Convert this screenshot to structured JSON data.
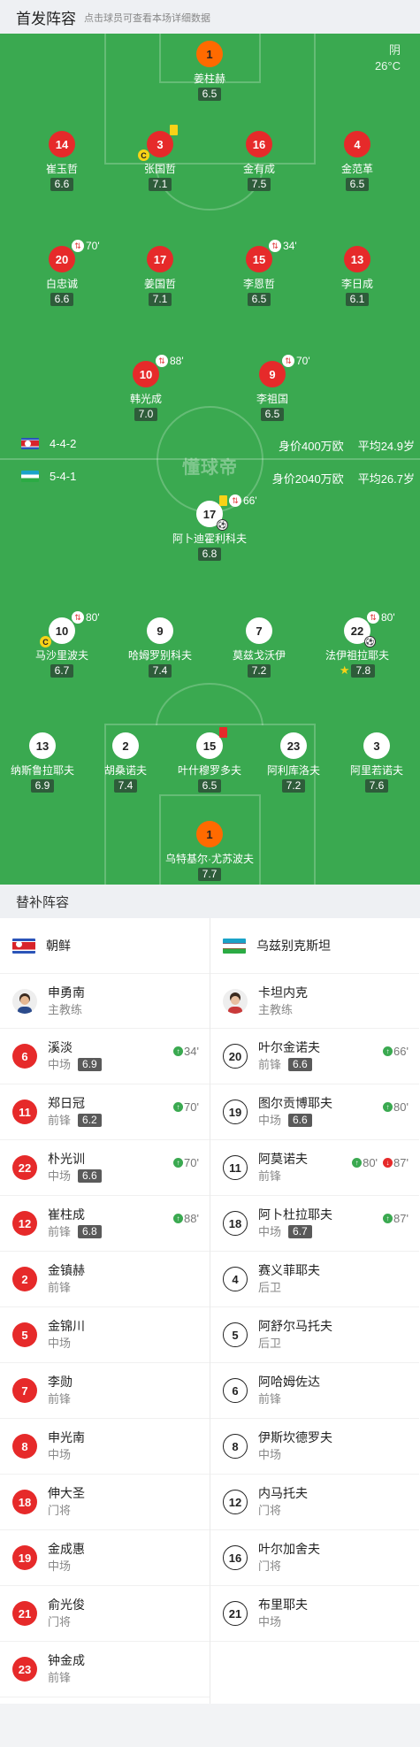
{
  "header": {
    "title": "首发阵容",
    "subtitle": "点击球员可查看本场详细数据"
  },
  "weather": {
    "condition": "阴",
    "temp": "26°C"
  },
  "watermark": "懂球帝",
  "home": {
    "formation": "4-4-2",
    "value": "身价400万欧",
    "age": "平均24.9岁",
    "name": "朝鲜",
    "players": [
      {
        "num": "1",
        "name": "姜柱赫",
        "rating": "6.5",
        "kit": "or"
      },
      {
        "num": "14",
        "name": "崔玉哲",
        "rating": "6.6",
        "kit": "red"
      },
      {
        "num": "3",
        "name": "张国哲",
        "rating": "7.1",
        "kit": "red",
        "captain": "C",
        "yellow": true
      },
      {
        "num": "16",
        "name": "金有成",
        "rating": "7.5",
        "kit": "red"
      },
      {
        "num": "4",
        "name": "金范革",
        "rating": "6.5",
        "kit": "red"
      },
      {
        "num": "20",
        "name": "白忠诚",
        "rating": "6.6",
        "kit": "red",
        "sub": "70'"
      },
      {
        "num": "17",
        "name": "姜国哲",
        "rating": "7.1",
        "kit": "red"
      },
      {
        "num": "15",
        "name": "李恩哲",
        "rating": "6.5",
        "kit": "red",
        "sub": "34'"
      },
      {
        "num": "13",
        "name": "李日成",
        "rating": "6.1",
        "kit": "red"
      },
      {
        "num": "10",
        "name": "韩光成",
        "rating": "7.0",
        "kit": "red",
        "sub": "88'"
      },
      {
        "num": "9",
        "name": "李祖国",
        "rating": "6.5",
        "kit": "red",
        "sub": "70'"
      }
    ]
  },
  "away": {
    "formation": "5-4-1",
    "value": "身价2040万欧",
    "age": "平均26.7岁",
    "name": "乌兹别克斯坦",
    "players": [
      {
        "num": "17",
        "name": "阿卜迪霍利科夫",
        "rating": "6.8",
        "kit": "wh",
        "yellow": true,
        "sub": "66'"
      },
      {
        "num": "10",
        "name": "马沙里波夫",
        "rating": "6.7",
        "kit": "wh",
        "captain": "C",
        "sub": "80'"
      },
      {
        "num": "9",
        "name": "哈姆罗别科夫",
        "rating": "7.4",
        "kit": "wh"
      },
      {
        "num": "7",
        "name": "莫兹戈沃伊",
        "rating": "7.2",
        "kit": "wh"
      },
      {
        "num": "22",
        "name": "法伊祖拉耶夫",
        "rating": "7.8",
        "kit": "wh",
        "sub": "80'",
        "star": "★"
      },
      {
        "num": "13",
        "name": "纳斯鲁拉耶夫",
        "rating": "6.9",
        "kit": "wh"
      },
      {
        "num": "2",
        "name": "胡桑诺夫",
        "rating": "7.4",
        "kit": "wh"
      },
      {
        "num": "15",
        "name": "叶什穆罗多夫",
        "rating": "6.5",
        "kit": "wh",
        "red": true
      },
      {
        "num": "23",
        "name": "阿利库洛夫",
        "rating": "7.2",
        "kit": "wh"
      },
      {
        "num": "3",
        "name": "阿里若诺夫",
        "rating": "7.6",
        "kit": "wh"
      },
      {
        "num": "1",
        "name": "乌特基尔·尤苏波夫",
        "rating": "7.7",
        "kit": "or"
      }
    ]
  },
  "subs": {
    "title": "替补阵容",
    "home_coach": {
      "name": "申勇南",
      "role": "主教练"
    },
    "away_coach": {
      "name": "卡坦内克",
      "role": "主教练"
    },
    "home": [
      {
        "num": "6",
        "name": "溪淡",
        "pos": "中场",
        "rating": "6.9",
        "in": "34'"
      },
      {
        "num": "11",
        "name": "郑日冠",
        "pos": "前锋",
        "rating": "6.2",
        "in": "70'"
      },
      {
        "num": "22",
        "name": "朴光训",
        "pos": "中场",
        "rating": "6.6",
        "in": "70'"
      },
      {
        "num": "12",
        "name": "崔柱成",
        "pos": "前锋",
        "rating": "6.8",
        "in": "88'"
      },
      {
        "num": "2",
        "name": "金镇赫",
        "pos": "前锋"
      },
      {
        "num": "5",
        "name": "金锦川",
        "pos": "中场"
      },
      {
        "num": "7",
        "name": "李勋",
        "pos": "前锋"
      },
      {
        "num": "8",
        "name": "申光南",
        "pos": "中场"
      },
      {
        "num": "18",
        "name": "伸大圣",
        "pos": "门将"
      },
      {
        "num": "19",
        "name": "金成惠",
        "pos": "中场"
      },
      {
        "num": "21",
        "name": "俞光俊",
        "pos": "门将"
      },
      {
        "num": "23",
        "name": "钟金成",
        "pos": "前锋"
      }
    ],
    "away": [
      {
        "num": "20",
        "name": "叶尔金诺夫",
        "pos": "前锋",
        "rating": "6.6",
        "in": "66'"
      },
      {
        "num": "19",
        "name": "图尔贡博耶夫",
        "pos": "中场",
        "rating": "6.6",
        "in": "80'"
      },
      {
        "num": "11",
        "name": "阿莫诺夫",
        "pos": "前锋",
        "in": "80'",
        "out": "87'"
      },
      {
        "num": "18",
        "name": "阿卜杜拉耶夫",
        "pos": "中场",
        "rating": "6.7",
        "in": "87'"
      },
      {
        "num": "4",
        "name": "赛义菲耶夫",
        "pos": "后卫"
      },
      {
        "num": "5",
        "name": "阿舒尔马托夫",
        "pos": "后卫"
      },
      {
        "num": "6",
        "name": "阿哈姆佐达",
        "pos": "前锋"
      },
      {
        "num": "8",
        "name": "伊斯坎德罗夫",
        "pos": "中场"
      },
      {
        "num": "12",
        "name": "内马托夫",
        "pos": "门将"
      },
      {
        "num": "16",
        "name": "叶尔加舍夫",
        "pos": "门将"
      },
      {
        "num": "21",
        "name": "布里耶夫",
        "pos": "中场"
      }
    ]
  }
}
